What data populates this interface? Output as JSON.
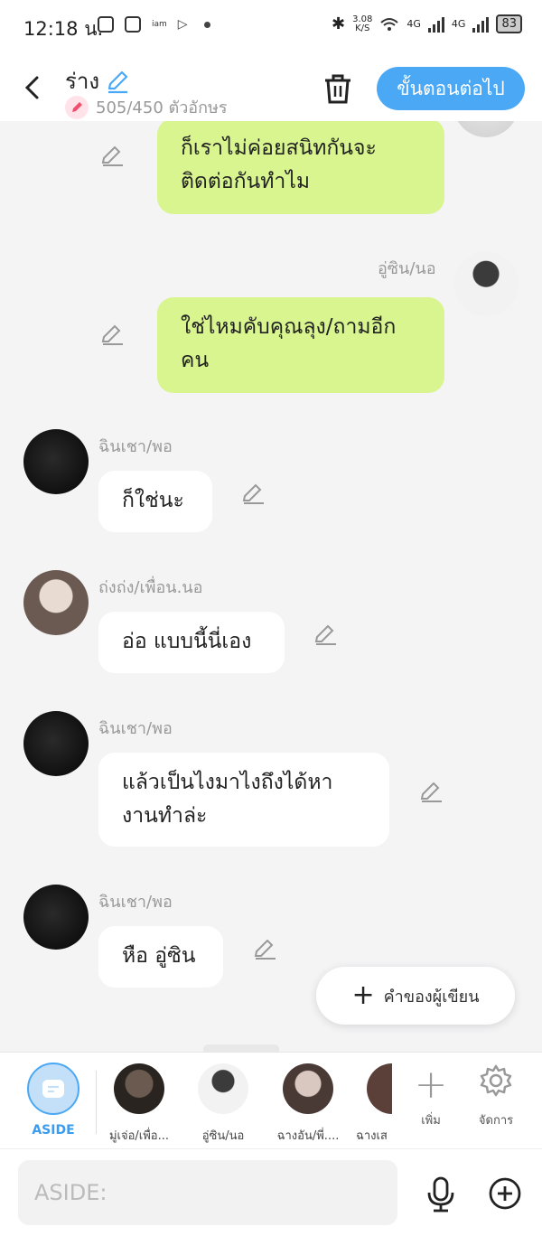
{
  "status_bar": {
    "time": "12:18 น.",
    "net_speed": "3.08",
    "net_unit": "K/S",
    "net1": "4G",
    "net2": "4G",
    "battery": "83"
  },
  "header": {
    "title": "ร่าง",
    "char_count": "505/450 ตัวอักษร",
    "next_button": "ขั้นตอนต่อไป"
  },
  "messages": [
    {
      "text": "ก็เราไม่ค่อยสนิทกันจะติดต่อกันทำไม"
    },
    {
      "speaker": "อู่ซิน/นอ",
      "text": "ใช่ไหมคับคุณลุง/ถามอีกคน"
    },
    {
      "speaker": "ฉินเชา/พอ",
      "text": "ก็ใช่นะ"
    },
    {
      "speaker": "ถ่งถ่ง/เพื่อน.นอ",
      "text": "อ่อ แบบนี้นี่เอง"
    },
    {
      "speaker": "ฉินเชา/พอ",
      "text": "แล้วเป็นไงมาไงถึงได้หางานทำล่ะ"
    },
    {
      "speaker": "ฉินเชา/พอ",
      "text": "หือ อู่ซิน"
    }
  ],
  "author_note_button": "คำของผู้เขียน",
  "characters": {
    "aside_label": "ASIDE",
    "items": [
      "มู่เจ่อ/เพื่อ...",
      "อู่ซิน/นอ",
      "ฉางอัน/พี่....",
      "ฉางเส"
    ],
    "add_label": "เพิ่ม",
    "manage_label": "จัดการ"
  },
  "composer": {
    "placeholder": "ASIDE:"
  },
  "colors": {
    "accent": "#4aa8f5",
    "my_bubble": "#d8f58f",
    "other_bubble": "#ffffff"
  }
}
